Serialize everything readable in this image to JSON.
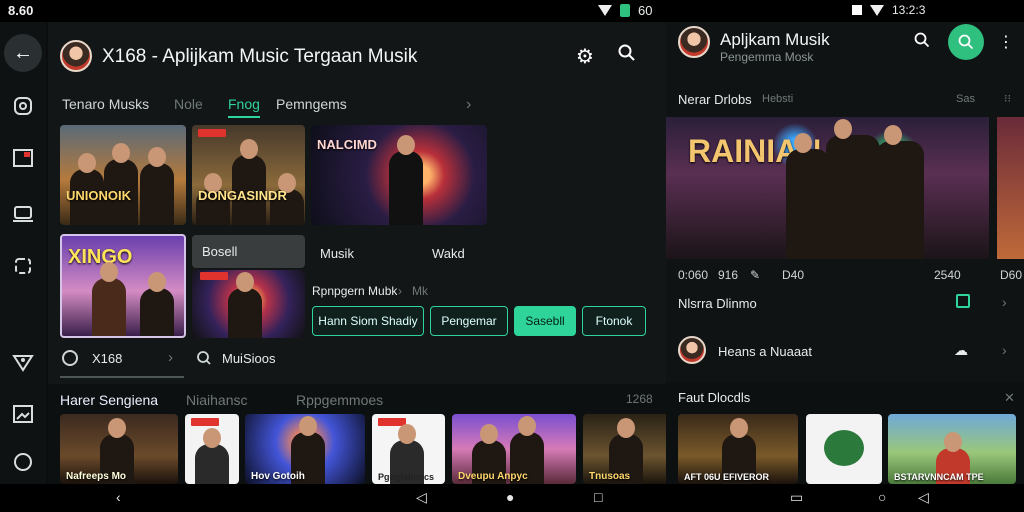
{
  "status": {
    "time": "8.60",
    "right_left": "60",
    "right_right": "13:2:3"
  },
  "rail": {
    "icons": [
      "back-arrow-icon",
      "clock-icon",
      "media-icon",
      "laptop-icon",
      "sync-icon",
      "shield-icon",
      "image-icon",
      "circle-icon"
    ]
  },
  "panelA": {
    "title": "X168 - Aplijkam Music Tergaan Musik",
    "tabs": [
      {
        "label": "Tenaro Musks",
        "state": "normal"
      },
      {
        "label": "Nole",
        "state": "muted"
      },
      {
        "label": "Fnog",
        "state": "active"
      },
      {
        "label": "Pemngems",
        "state": "normal"
      }
    ],
    "tabs_arrow": "›",
    "row1": [
      {
        "caption": "UNIONOIK"
      },
      {
        "caption": "DONGASINDR"
      },
      {
        "caption": "NALCIMD"
      }
    ],
    "row2": [
      {
        "caption": "XINGO"
      },
      {
        "caption": ""
      }
    ],
    "row2_labels": {
      "tab1": "Bosell",
      "tab2": "Musik",
      "tab3": "Wakd"
    },
    "filter_label": "Rpnpgern Mubk",
    "filter_arrow": "›",
    "filter_hint": "Mk",
    "chips": [
      {
        "label": "Hann Siom Shadiy",
        "active": false
      },
      {
        "label": "Pengemar",
        "active": false
      },
      {
        "label": "Sasebll",
        "active": true
      },
      {
        "label": "Ftonok",
        "active": false
      }
    ],
    "search_row": {
      "left": "X168",
      "right": "MuiSioos"
    },
    "section": {
      "title": "Harer Sengiena",
      "hint": "Niaihansc",
      "hint2": "Rppgemmoes",
      "count": "1268"
    },
    "bottom_thumbs": [
      "Nafreeps Mo",
      "",
      "Hov Gotoih",
      "Pgegfalioncs",
      "Dveupu Anpyc",
      "Tnusoas"
    ]
  },
  "panelB": {
    "title": "Apljkam Musik",
    "subtitle": "Pengemma Mosk",
    "section1": {
      "title": "Nerar Drlobs",
      "hint": "Hebsti",
      "right": "Sas"
    },
    "hero_caption": "RAINIAN",
    "meta": {
      "time": "0:060",
      "num": "916",
      "rating": "D40",
      "size": "2540",
      "right": "D60"
    },
    "row_items": [
      {
        "label": "Nlsrra Dlinmo"
      },
      {
        "label": "Heans a Nuaaat"
      }
    ],
    "section2": {
      "title": "Faut Dlocdls"
    },
    "thumb_captions": [
      "AFT 06U EFlVEROR",
      "",
      "BSTARVNNCAM TPE"
    ]
  },
  "colors": {
    "accent": "#2fd49a",
    "fab": "#2fbf7f",
    "bg": "#121617"
  }
}
